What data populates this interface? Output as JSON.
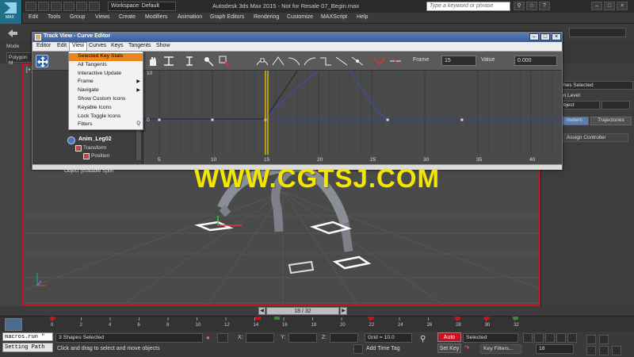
{
  "app": {
    "title": "Autodesk 3ds Max  2015  - Not for Resale   07_Begin.max",
    "logo_label": "MAX",
    "workspace": "Workspace: Default",
    "search_placeholder": "Type a keyword or phrase"
  },
  "menubar": [
    "Edit",
    "Tools",
    "Group",
    "Views",
    "Create",
    "Modifiers",
    "Animation",
    "Graph Editors",
    "Rendering",
    "Customize",
    "MAXScript",
    "Help"
  ],
  "ribbon": {
    "polygon_label": "Polygon M",
    "mode_label": "Mode"
  },
  "viewport": {
    "label": "[+]",
    "label_color": "#c4141f"
  },
  "track_view": {
    "title": "Track View - Curve Editor",
    "menu": [
      "Editor",
      "Edit",
      "View",
      "Curves",
      "Keys",
      "Tangents",
      "Show"
    ],
    "open_menu": "View",
    "frame_label": "Frame",
    "frame_value": "15",
    "value_label": "Value",
    "value_value": "0.000",
    "tree": [
      "Object (Editable Splin",
      "Anim_Leg02",
      "Transform",
      "Position"
    ],
    "graph_y_labels": [
      "10",
      "0"
    ],
    "graph_x_labels": [
      "5",
      "10",
      "15",
      "20",
      "25",
      "30",
      "35",
      "40"
    ],
    "current_frame": 15
  },
  "view_menu": [
    {
      "label": "Selected Key Stats",
      "highlight": true
    },
    {
      "label": "All Tangents"
    },
    {
      "label": "Interactive Update"
    },
    {
      "label": "Frame",
      "submenu": true
    },
    {
      "label": "Navigate",
      "submenu": true
    },
    {
      "label": "Show Custom Icons"
    },
    {
      "label": "Keyable Icons"
    },
    {
      "label": "Lock Toggle Icons"
    },
    {
      "label": "Filters",
      "shortcut": "Q"
    }
  ],
  "watermark": "WWW.CGTSJ.COM",
  "right_panel": {
    "selection": "hes Selected",
    "selection_level": "on Level:",
    "object_dropdown": "bject",
    "tab_parameters": "meters",
    "tab_trajectories": "Trajectories",
    "assign_controller": "Assign Controller"
  },
  "timeline": {
    "position": "18 / 32",
    "ticks": [
      "0",
      "2",
      "4",
      "6",
      "8",
      "10",
      "12",
      "14",
      "16",
      "18",
      "20",
      "22",
      "24",
      "26",
      "28",
      "30",
      "32"
    ]
  },
  "status": {
    "maxscript_listener": "macros.run \"",
    "set_path": "Setting Path",
    "selected": "3 Shapes Selected",
    "prompt": "Click and drag to select and move objects",
    "x_label": "X:",
    "y_label": "Y:",
    "z_label": "Z:",
    "grid": "Grid = 10.0",
    "add_time_tag": "Add Time Tag",
    "auto_key": "Auto Key",
    "set_key": "Set Key",
    "selected_dropdown": "Selected",
    "key_filters": "Key Filters...",
    "frame_field": "18"
  },
  "colors": {
    "accent": "#e7861f",
    "viewport_border": "#c4141f",
    "watermark": "#f3e600",
    "track_title": "#3b5c96"
  }
}
